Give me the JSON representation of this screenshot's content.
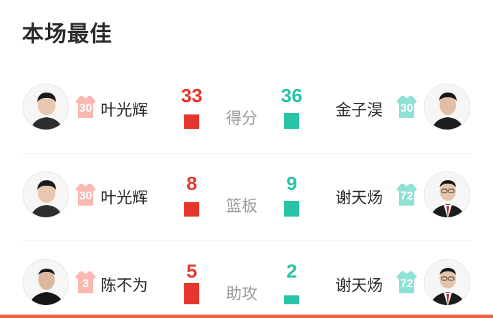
{
  "title": "本场最佳",
  "colors": {
    "home": "#e8352b",
    "away": "#27c4a6",
    "home_jersey": "#f9b8b0",
    "away_jersey": "#8fe1d3",
    "accent": "#f0643c"
  },
  "rows": [
    {
      "category": "得分",
      "home": {
        "player": "叶光辉",
        "number": "30",
        "value": "33",
        "share": 0.48
      },
      "away": {
        "player": "金子淏",
        "number": "30",
        "value": "36",
        "share": 0.52
      }
    },
    {
      "category": "篮板",
      "home": {
        "player": "叶光辉",
        "number": "30",
        "value": "8",
        "share": 0.47
      },
      "away": {
        "player": "谢天炀",
        "number": "72",
        "value": "9",
        "share": 0.53
      }
    },
    {
      "category": "助攻",
      "home": {
        "player": "陈不为",
        "number": "3",
        "value": "5",
        "share": 0.71
      },
      "away": {
        "player": "谢天炀",
        "number": "72",
        "value": "2",
        "share": 0.29
      }
    }
  ]
}
